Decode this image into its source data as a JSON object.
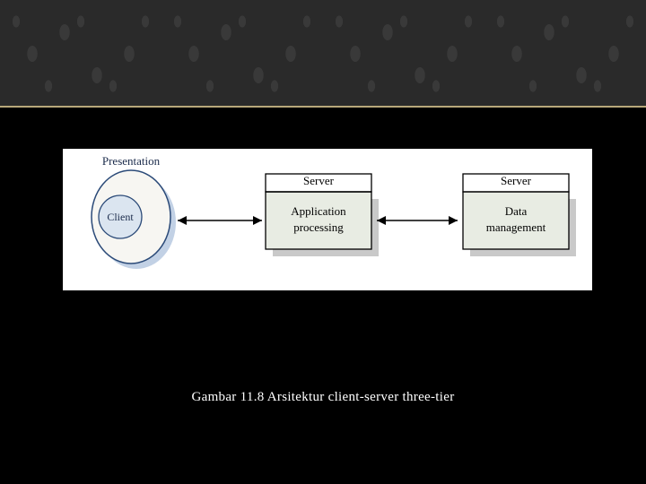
{
  "diagram": {
    "tier1": {
      "group_label": "Presentation",
      "node_label": "Client"
    },
    "tier2": {
      "group_label": "Server",
      "node_label_line1": "Application",
      "node_label_line2": "processing"
    },
    "tier3": {
      "group_label": "Server",
      "node_label_line1": "Data",
      "node_label_line2": "management"
    }
  },
  "caption": "Gambar 11.8 Arsitektur client-server three-tier"
}
